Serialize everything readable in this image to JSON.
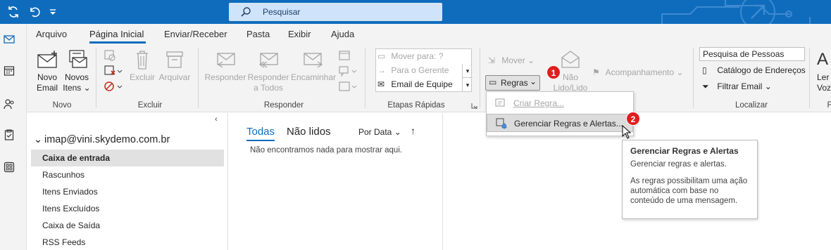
{
  "titlebar": {
    "search_placeholder": "Pesquisar",
    "accent": "#0f6cbd"
  },
  "ribbon": {
    "tabs": [
      {
        "label": "Arquivo"
      },
      {
        "label": "Página Inicial",
        "active": true
      },
      {
        "label": "Enviar/Receber"
      },
      {
        "label": "Pasta"
      },
      {
        "label": "Exibir"
      },
      {
        "label": "Ajuda"
      }
    ],
    "groups": {
      "novo": {
        "label": "Novo",
        "novo_email": "Novo",
        "novo_email_2": "Email",
        "novos_itens": "Novos",
        "novos_itens_2": "Itens"
      },
      "excluir": {
        "label": "Excluir",
        "excluir": "Excluir",
        "arquivar": "Arquivar"
      },
      "responder": {
        "label": "Responder",
        "responder": "Responder",
        "responder_todos_1": "Responder",
        "responder_todos_2": "a Todos",
        "encaminhar": "Encaminhar"
      },
      "etapas": {
        "label": "Etapas Rápidas",
        "items": [
          "Mover para: ?",
          "Para o Gerente",
          "Email de Equipe"
        ]
      },
      "mover": {
        "mover": "Mover",
        "regras": "Regras",
        "nao_lido_1": "Não",
        "nao_lido_2": "Lido/Lido",
        "acompanhamento": "Acompanhamento"
      },
      "localizar": {
        "label": "Localizar",
        "pesquisa_pessoas": "Pesquisa de Pessoas",
        "catalogo": "Catálogo de Endereços",
        "filtrar": "Filtrar Email"
      },
      "fala": {
        "ler_1": "Ler",
        "ler_2": "Voz",
        "label": "F"
      }
    }
  },
  "folders": {
    "account": "imap@vini.skydemo.com.br",
    "items": [
      {
        "label": "Caixa de entrada",
        "selected": true
      },
      {
        "label": "Rascunhos"
      },
      {
        "label": "Itens Enviados"
      },
      {
        "label": "Itens Excluídos"
      },
      {
        "label": "Caixa de Saída"
      },
      {
        "label": "RSS Feeds"
      }
    ]
  },
  "message_list": {
    "tab_all": "Todas",
    "tab_unread": "Não lidos",
    "sort_label": "Por Data",
    "empty_text": "Não encontramos nada para mostrar aqui."
  },
  "rules_menu": {
    "items": [
      {
        "label": "Criar Regra...",
        "disabled": true
      },
      {
        "label": "Gerenciar Regras e Alertas...",
        "hover": true
      }
    ]
  },
  "tooltip": {
    "title": "Gerenciar Regras e Alertas",
    "body": "Gerenciar regras e alertas.",
    "detail": "As regras possibilitam uma ação automática com base no conteúdo de uma mensagem."
  },
  "badges": [
    "1",
    "2"
  ],
  "badge_color": "#e01e1e"
}
